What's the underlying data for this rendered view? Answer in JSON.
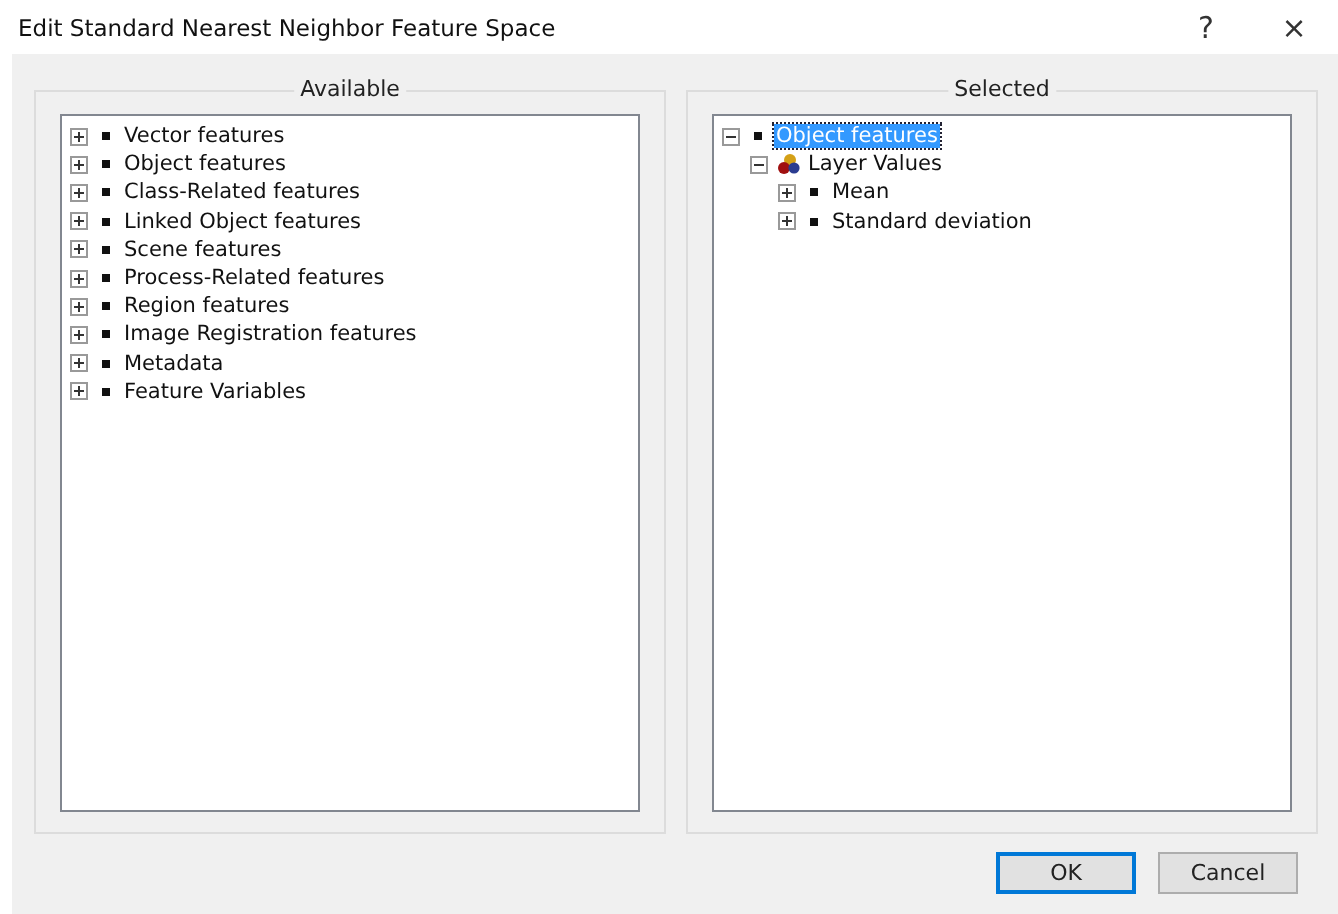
{
  "window": {
    "title": "Edit Standard Nearest Neighbor Feature Space",
    "help": "?",
    "close": "×"
  },
  "available": {
    "title": "Available",
    "items": [
      {
        "label": "Vector features",
        "kind": "bullet",
        "expanded": false,
        "selected": false
      },
      {
        "label": "Object features",
        "kind": "bullet",
        "expanded": false,
        "selected": false
      },
      {
        "label": "Class-Related features",
        "kind": "bullet",
        "expanded": false,
        "selected": false
      },
      {
        "label": "Linked Object features",
        "kind": "bullet",
        "expanded": false,
        "selected": false
      },
      {
        "label": "Scene features",
        "kind": "bullet",
        "expanded": false,
        "selected": false
      },
      {
        "label": "Process-Related features",
        "kind": "bullet",
        "expanded": false,
        "selected": false
      },
      {
        "label": "Region features",
        "kind": "bullet",
        "expanded": false,
        "selected": false
      },
      {
        "label": "Image Registration features",
        "kind": "bullet",
        "expanded": false,
        "selected": false
      },
      {
        "label": "Metadata",
        "kind": "bullet",
        "expanded": false,
        "selected": false
      },
      {
        "label": "Feature Variables",
        "kind": "bullet",
        "expanded": false,
        "selected": false
      }
    ]
  },
  "selected": {
    "title": "Selected",
    "items": [
      {
        "label": "Object features",
        "kind": "bullet",
        "expanded": true,
        "selected": true,
        "children": [
          {
            "label": "Layer Values",
            "kind": "layers",
            "expanded": true,
            "selected": false,
            "children": [
              {
                "label": "Mean",
                "kind": "bullet",
                "expanded": false,
                "selected": false
              },
              {
                "label": "Standard deviation",
                "kind": "bullet",
                "expanded": false,
                "selected": false
              }
            ]
          }
        ]
      }
    ]
  },
  "buttons": [
    {
      "label": "OK",
      "default": true
    },
    {
      "label": "Cancel",
      "default": false
    }
  ]
}
